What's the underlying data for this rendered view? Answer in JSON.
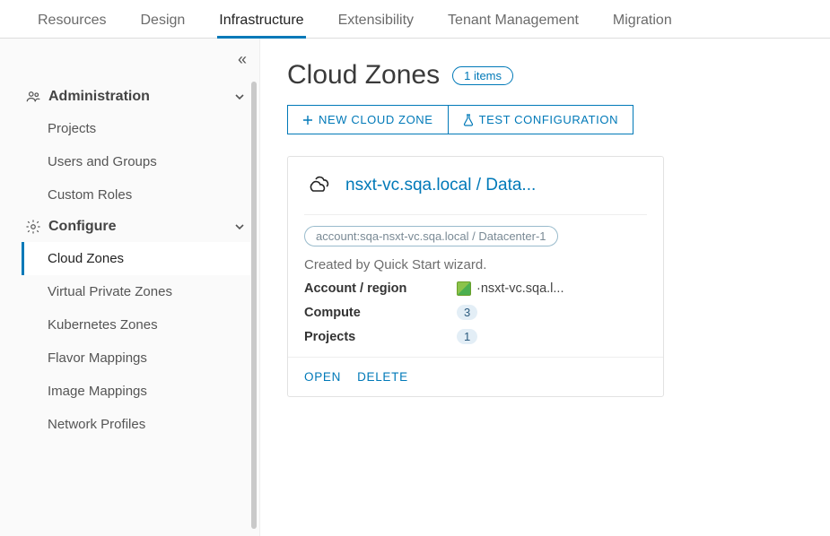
{
  "tabs": {
    "items": [
      {
        "label": "Resources"
      },
      {
        "label": "Design"
      },
      {
        "label": "Infrastructure"
      },
      {
        "label": "Extensibility"
      },
      {
        "label": "Tenant Management"
      },
      {
        "label": "Migration"
      }
    ],
    "active_index": 2
  },
  "sidebar": {
    "sections": [
      {
        "label": "Administration",
        "items": [
          {
            "label": "Projects"
          },
          {
            "label": "Users and Groups"
          },
          {
            "label": "Custom Roles"
          }
        ]
      },
      {
        "label": "Configure",
        "items": [
          {
            "label": "Cloud Zones"
          },
          {
            "label": "Virtual Private Zones"
          },
          {
            "label": "Kubernetes Zones"
          },
          {
            "label": "Flavor Mappings"
          },
          {
            "label": "Image Mappings"
          },
          {
            "label": "Network Profiles"
          }
        ]
      }
    ],
    "selected": "Cloud Zones"
  },
  "page": {
    "title": "Cloud Zones",
    "count_badge": "1 items",
    "actions": {
      "new": "NEW CLOUD ZONE",
      "test": "TEST CONFIGURATION"
    }
  },
  "card": {
    "title": "nsxt-vc.sqa.local / Data...",
    "tag": "account:sqa-nsxt-vc.sqa.local / Datacenter-1",
    "desc": "Created by Quick Start wizard.",
    "kv": {
      "account_label": "Account / region",
      "account_value": "·nsxt-vc.sqa.l...",
      "compute_label": "Compute",
      "compute_value": "3",
      "projects_label": "Projects",
      "projects_value": "1"
    },
    "footer": {
      "open": "OPEN",
      "delete": "DELETE"
    }
  }
}
